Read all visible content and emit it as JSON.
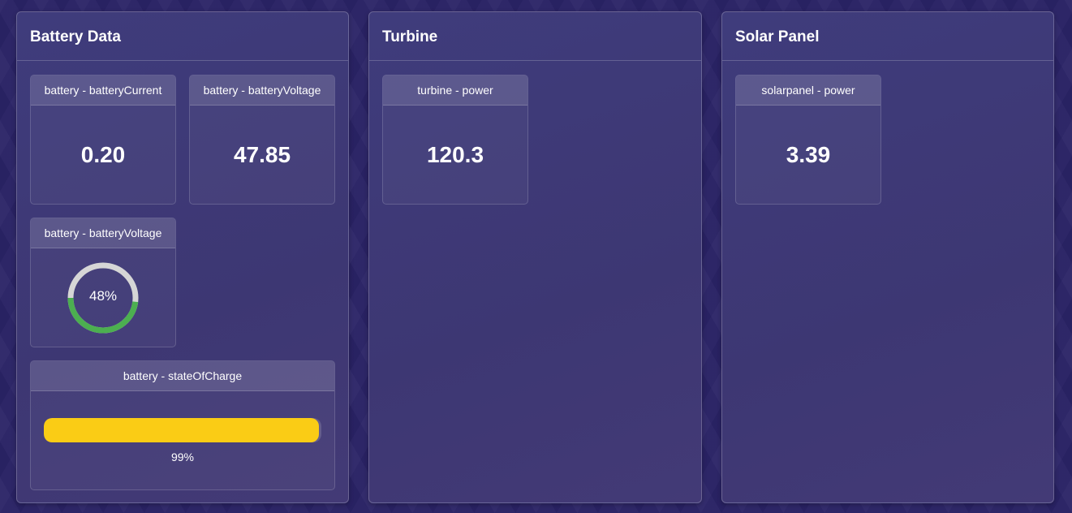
{
  "panels": {
    "battery": {
      "title": "Battery Data",
      "current": {
        "label": "battery - batteryCurrent",
        "value": "0.20"
      },
      "voltage": {
        "label": "battery - batteryVoltage",
        "value": "47.85"
      },
      "voltage_gauge": {
        "label": "battery - batteryVoltage",
        "percent_text": "48%",
        "percent": 48,
        "fill_color": "#4caf50",
        "track_color": "#d6d6d6"
      },
      "state_of_charge": {
        "label": "battery - stateOfCharge",
        "percent_text": "99%",
        "percent": 99,
        "fill_color": "#facc15"
      }
    },
    "turbine": {
      "title": "Turbine",
      "power": {
        "label": "turbine - power",
        "value": "120.3"
      }
    },
    "solar": {
      "title": "Solar Panel",
      "power": {
        "label": "solarpanel - power",
        "value": "3.39"
      }
    }
  }
}
